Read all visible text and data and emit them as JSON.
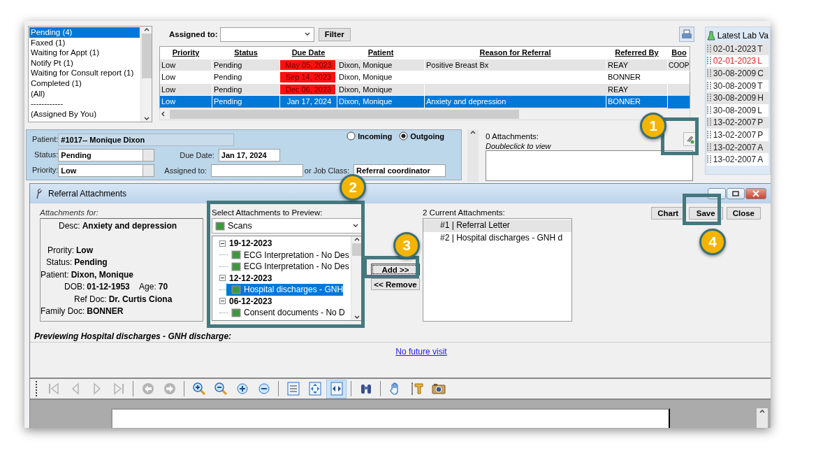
{
  "status_list": {
    "items": [
      {
        "label": "Pending (4)",
        "selected": true
      },
      {
        "label": "Faxed (1)",
        "selected": false
      },
      {
        "label": "Waiting for Appt (1)",
        "selected": false
      },
      {
        "label": "Notify Pt (1)",
        "selected": false
      },
      {
        "label": "Waiting for Consult report (1)",
        "selected": false
      },
      {
        "label": "Completed (1)",
        "selected": false
      },
      {
        "label": "(All)",
        "selected": false
      },
      {
        "label": "------------",
        "selected": false
      },
      {
        "label": "(Assigned By You)",
        "selected": false
      }
    ]
  },
  "filter": {
    "label": "Assigned to:",
    "button": "Filter"
  },
  "referrals": {
    "columns": [
      "Priority",
      "Status",
      "Due Date",
      "Patient",
      "Reason for Referral",
      "Referred By",
      "Boo"
    ],
    "rows": [
      {
        "cells": [
          "Low",
          "Pending",
          "May 05, 2023",
          "Dixon, Monique",
          "Positive Breast Bx",
          "REAY",
          "COOP"
        ],
        "overdue": true,
        "selected": false
      },
      {
        "cells": [
          "Low",
          "Pending",
          "Sep 14, 2023",
          "Dixon, Monique",
          null,
          "BONNER",
          null
        ],
        "overdue": true,
        "selected": false
      },
      {
        "cells": [
          "Low",
          "Pending",
          "Dec 06, 2023",
          "Dixon, Monique",
          null,
          "REAY",
          null
        ],
        "overdue": true,
        "selected": false
      },
      {
        "cells": [
          "Low",
          "Pending",
          "Jan 17, 2024",
          "Dixon, Monique",
          "Anxiety and depression",
          "BONNER",
          null
        ],
        "overdue": false,
        "selected": true
      }
    ]
  },
  "referral_form": {
    "patient_label": "Patient:",
    "patient": "#1017-- Monique Dixon",
    "direction": [
      {
        "label": "Incoming",
        "selected": false
      },
      {
        "label": "Outgoing",
        "selected": true
      }
    ],
    "status_label": "Status:",
    "status": "Pending",
    "due_label": "Due Date:",
    "due": "Jan 17, 2024",
    "priority_label": "Priority:",
    "priority": "Low",
    "assigned_label": "Assigned to:",
    "job_label": "or Job Class:",
    "job": "Referral coordinator"
  },
  "attachments_panel": {
    "title": "0 Attachments:",
    "hint": "Doubleclick to view"
  },
  "lab_values": {
    "title": "Latest Lab Va",
    "rows": [
      {
        "date": "02-01-2023",
        "name": "T",
        "abnormal": false
      },
      {
        "date": "02-01-2023",
        "name": "L",
        "abnormal": true
      },
      {
        "date": "30-08-2009",
        "name": "C",
        "abnormal": false
      },
      {
        "date": "30-08-2009",
        "name": "T",
        "abnormal": false
      },
      {
        "date": "30-08-2009",
        "name": "H",
        "abnormal": false
      },
      {
        "date": "30-08-2009",
        "name": "L",
        "abnormal": false
      },
      {
        "date": "13-02-2007",
        "name": "P",
        "abnormal": false
      },
      {
        "date": "13-02-2007",
        "name": "P",
        "abnormal": false
      },
      {
        "date": "13-02-2007",
        "name": "A",
        "abnormal": false
      },
      {
        "date": "13-02-2007",
        "name": "A",
        "abnormal": false
      }
    ]
  },
  "dialog": {
    "title": "Referral Attachments",
    "for_label": "Attachments for:",
    "details": [
      {
        "label": "Desc:",
        "value": "Anxiety and depression"
      },
      {
        "label": "Prority:",
        "value": "Low"
      },
      {
        "label": "Status:",
        "value": "Pending"
      },
      {
        "label": "Patient:",
        "value": "Dixon, Monique"
      },
      {
        "label": "DOB:",
        "value": "01-12-1953",
        "label2": "Age:",
        "value2": "70"
      },
      {
        "label": "Ref Doc:",
        "value": "Dr. Curtis Ciona"
      },
      {
        "label": "Family Doc:",
        "value": "BONNER"
      }
    ],
    "select_label": "Select Attachments to Preview:",
    "source": "Scans",
    "tree": [
      {
        "label": "19-12-2023",
        "expanded": true,
        "children": [
          {
            "label": "ECG Interpretation - No Des",
            "selected": false
          },
          {
            "label": "ECG Interpretation - No Des",
            "selected": false
          }
        ]
      },
      {
        "label": "12-12-2023",
        "expanded": true,
        "children": [
          {
            "label": "Hospital discharges - GNH",
            "selected": true
          }
        ]
      },
      {
        "label": "06-12-2023",
        "expanded": true,
        "children": [
          {
            "label": "Consent documents - No D",
            "selected": false
          }
        ]
      }
    ],
    "add_button": "Add >>",
    "remove_button": "<< Remove",
    "current_label": "2 Current Attachments:",
    "current": [
      {
        "label": "#1 | Referral Letter",
        "selected": true
      },
      {
        "label": "#2 | Hospital discharges - GNH d",
        "selected": false
      }
    ],
    "actions": [
      "Chart",
      "Save",
      "Close"
    ],
    "preview_label": "Previewing Hospital discharges - GNH discharge:",
    "link": "No future visit",
    "toolbar": [
      {
        "kind": "first",
        "disabled": true
      },
      {
        "kind": "prev",
        "disabled": true
      },
      {
        "kind": "next",
        "disabled": true
      },
      {
        "kind": "last",
        "disabled": true
      },
      {
        "kind": "back",
        "disabled": true
      },
      {
        "kind": "forward",
        "disabled": true
      },
      {
        "kind": "zoom-in",
        "disabled": false
      },
      {
        "kind": "zoom-out",
        "disabled": false
      },
      {
        "kind": "plus",
        "disabled": false
      },
      {
        "kind": "minus",
        "disabled": false
      },
      {
        "kind": "actual-size",
        "disabled": false
      },
      {
        "kind": "fit-page",
        "disabled": false
      },
      {
        "kind": "fit-width",
        "disabled": false,
        "selected": true
      },
      {
        "kind": "find",
        "disabled": false
      },
      {
        "kind": "hand",
        "disabled": false
      },
      {
        "kind": "text",
        "disabled": false
      },
      {
        "kind": "snapshot",
        "disabled": false
      }
    ]
  },
  "callouts": [
    {
      "label": "1"
    },
    {
      "label": "2"
    },
    {
      "label": "3"
    },
    {
      "label": "4"
    }
  ]
}
